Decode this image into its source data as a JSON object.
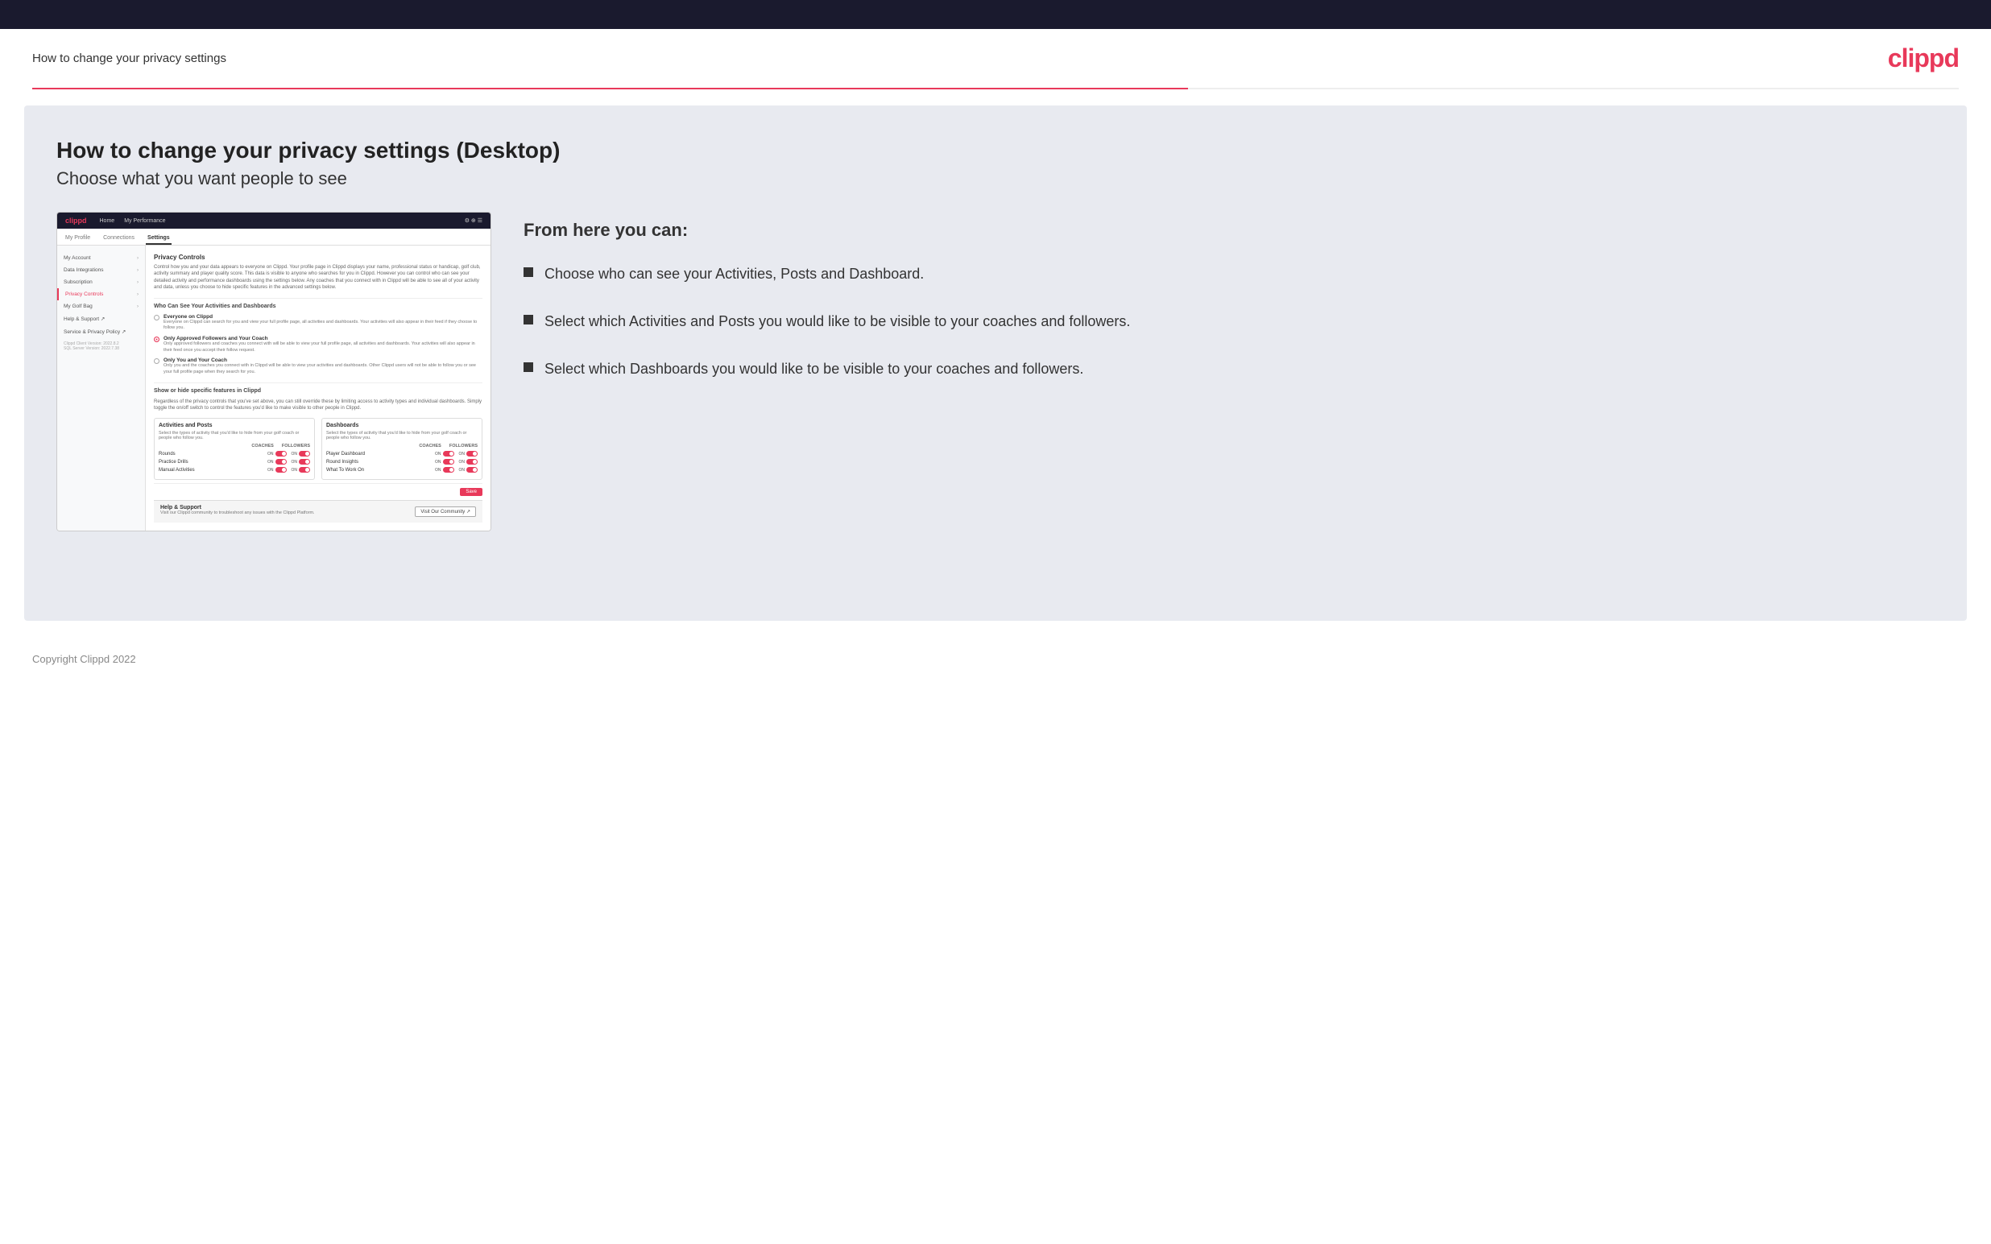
{
  "header": {
    "title": "How to change your privacy settings",
    "logo": "clippd"
  },
  "main": {
    "heading": "How to change your privacy settings (Desktop)",
    "subheading": "Choose what you want people to see",
    "right_panel_title": "From here you can:",
    "bullets": [
      {
        "text": "Choose who can see your Activities, Posts and Dashboard."
      },
      {
        "text": "Select which Activities and Posts you would like to be visible to your coaches and followers."
      },
      {
        "text": "Select which Dashboards you would like to be visible to your coaches and followers."
      }
    ]
  },
  "mockup": {
    "nav": {
      "logo": "clippd",
      "items": [
        "Home",
        "My Performance"
      ]
    },
    "tabs": [
      "My Profile",
      "Connections",
      "Settings"
    ],
    "sidebar": {
      "items": [
        {
          "label": "My Account",
          "has_arrow": true
        },
        {
          "label": "Data Integrations",
          "has_arrow": true
        },
        {
          "label": "Subscription",
          "has_arrow": true
        },
        {
          "label": "Privacy Controls",
          "has_arrow": true,
          "active": true
        },
        {
          "label": "My Golf Bag",
          "has_arrow": true
        },
        {
          "label": "Help & Support",
          "has_arrow": false
        },
        {
          "label": "Service & Privacy Policy",
          "has_arrow": false
        }
      ],
      "version": "Clippd Client Version: 2022.8.2\nSQL Server Version: 2022.7.38"
    },
    "content": {
      "section_title": "Privacy Controls",
      "section_desc": "Control how you and your data appears to everyone on Clippd. Your profile page in Clippd displays your name, professional status or handicap, golf club, activity summary and player quality score. This data is visible to anyone who searches for you in Clippd. However you can control who can see your detailed activity and performance dashboards using the settings below. Any coaches that you connect with in Clippd will be able to see all of your activity and data, unless you choose to hide specific features in the advanced settings below.",
      "visibility_title": "Who Can See Your Activities and Dashboards",
      "radio_options": [
        {
          "label": "Everyone on Clippd",
          "desc": "Everyone on Clippd can search for you and view your full profile page, all activities and dashboards. Your activities will also appear in their feed if they choose to follow you.",
          "selected": false
        },
        {
          "label": "Only Approved Followers and Your Coach",
          "desc": "Only approved followers and coaches you connect with will be able to view your full profile page, all activities and dashboards. Your activities will also appear in their feed once you accept their follow request.",
          "selected": true
        },
        {
          "label": "Only You and Your Coach",
          "desc": "Only you and the coaches you connect with in Clippd will be able to view your activities and dashboards. Other Clippd users will not be able to follow you or see your full profile page when they search for you.",
          "selected": false
        }
      ],
      "toggle_section_title": "Show or hide specific features in Clippd",
      "toggle_section_desc": "Regardless of the privacy controls that you've set above, you can still override these by limiting access to activity types and individual dashboards. Simply toggle the on/off switch to control the features you'd like to make visible to other people in Clippd.",
      "activities_box": {
        "title": "Activities and Posts",
        "desc": "Select the types of activity that you'd like to hide from your golf coach or people who follow you.",
        "columns": [
          "COACHES",
          "FOLLOWERS"
        ],
        "rows": [
          {
            "label": "Rounds",
            "coaches_on": true,
            "followers_on": true
          },
          {
            "label": "Practice Drills",
            "coaches_on": true,
            "followers_on": true
          },
          {
            "label": "Manual Activities",
            "coaches_on": true,
            "followers_on": true
          }
        ]
      },
      "dashboards_box": {
        "title": "Dashboards",
        "desc": "Select the types of activity that you'd like to hide from your golf coach or people who follow you.",
        "columns": [
          "COACHES",
          "FOLLOWERS"
        ],
        "rows": [
          {
            "label": "Player Dashboard",
            "coaches_on": true,
            "followers_on": true
          },
          {
            "label": "Round Insights",
            "coaches_on": true,
            "followers_on": true
          },
          {
            "label": "What To Work On",
            "coaches_on": true,
            "followers_on": true
          }
        ]
      },
      "save_label": "Save",
      "help_title": "Help & Support",
      "help_desc": "Visit our Clippd community to troubleshoot any issues with the Clippd Platform.",
      "visit_btn": "Visit Our Community"
    }
  },
  "footer": {
    "text": "Copyright Clippd 2022"
  }
}
